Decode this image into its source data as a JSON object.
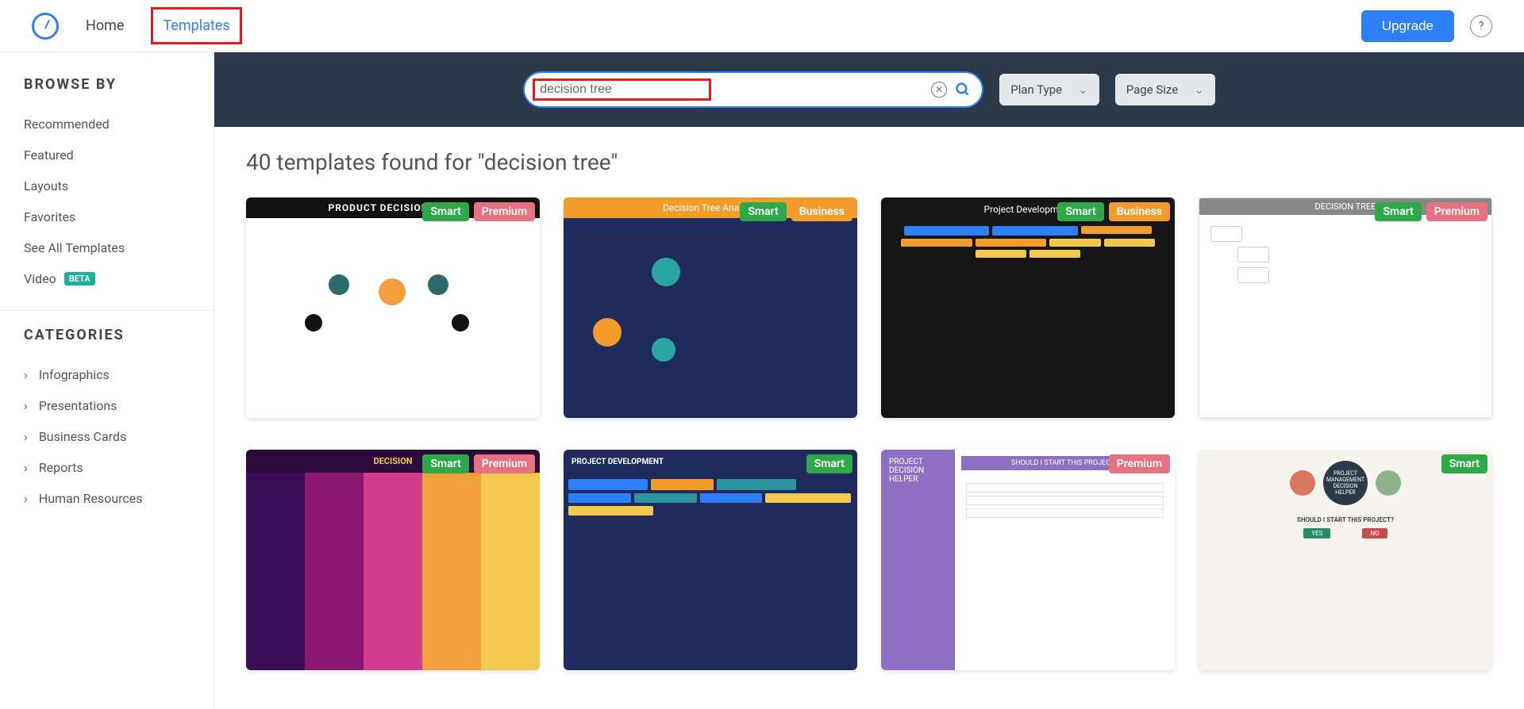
{
  "nav": {
    "home": "Home",
    "templates": "Templates",
    "upgrade": "Upgrade",
    "help": "?"
  },
  "sidebar": {
    "browse_heading": "BROWSE BY",
    "items": [
      {
        "label": "Recommended"
      },
      {
        "label": "Featured"
      },
      {
        "label": "Layouts"
      },
      {
        "label": "Favorites"
      },
      {
        "label": "See All Templates"
      },
      {
        "label": "Video",
        "beta": "BETA"
      }
    ],
    "categories_heading": "CATEGORIES",
    "categories": [
      {
        "label": "Infographics"
      },
      {
        "label": "Presentations"
      },
      {
        "label": "Business Cards"
      },
      {
        "label": "Reports"
      },
      {
        "label": "Human Resources"
      }
    ]
  },
  "search": {
    "value": "decision tree",
    "plan_type": "Plan Type",
    "page_size": "Page Size"
  },
  "results": {
    "count": 40,
    "title": "40 templates found for \"decision tree\""
  },
  "templates": [
    {
      "title": "PRODUCT DECISION TREE",
      "badges": [
        "Smart",
        "Premium"
      ]
    },
    {
      "title": "Decision Tree Analysis",
      "badges": [
        "Smart",
        "Business"
      ]
    },
    {
      "title": "Project Development",
      "badges": [
        "Smart",
        "Business"
      ]
    },
    {
      "title": "DECISION TREE",
      "badges": [
        "Smart",
        "Premium"
      ]
    },
    {
      "title": "DECISION",
      "badges": [
        "Smart",
        "Premium"
      ]
    },
    {
      "title": "PROJECT DEVELOPMENT",
      "badges": [
        "Smart"
      ]
    },
    {
      "title": "PROJECT DECISION HELPER",
      "subtitle": "SHOULD I START THIS PROJECT?",
      "badges": [
        "Premium"
      ]
    },
    {
      "title": "PROJECT MANAGEMENT DECISION HELPER",
      "subtitle": "SHOULD I START THIS PROJECT?",
      "badges": [
        "Smart"
      ]
    }
  ]
}
